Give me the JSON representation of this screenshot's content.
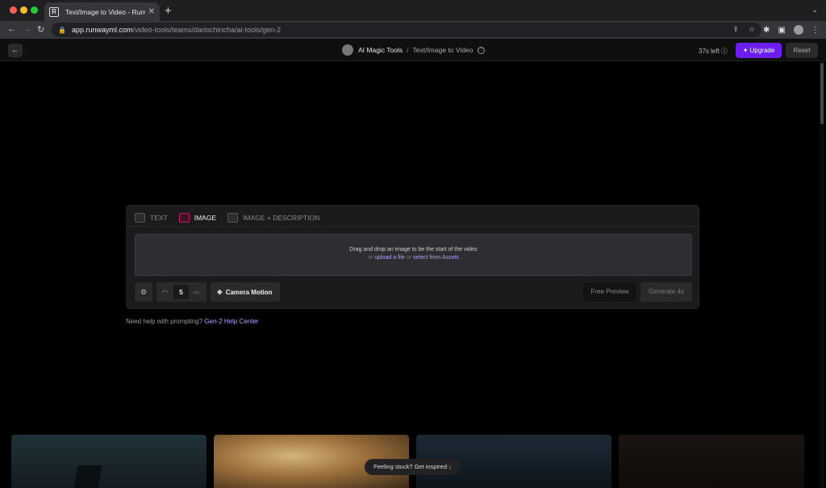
{
  "browser": {
    "tab_title": "Text/Image to Video - Runway",
    "favicon": "R",
    "url_host": "app.runwayml.com",
    "url_path": "/video-tools/teams/dariochincha/ai-tools/gen-2"
  },
  "header": {
    "breadcrumb_main": "AI Magic Tools",
    "breadcrumb_sep": "/",
    "breadcrumb_sub": "Text/Image to Video",
    "help_icon": "?",
    "time_left": "37s left ⓘ",
    "upgrade_label": "Upgrade",
    "reset_label": "Reset"
  },
  "panel": {
    "tabs": [
      {
        "label": "TEXT"
      },
      {
        "label": "IMAGE"
      },
      {
        "label": "IMAGE + DESCRIPTION"
      }
    ],
    "active_tab": "IMAGE",
    "dropzone": {
      "line1": "Drag and drop an image to be the start of the video",
      "or1": "or",
      "upload_link": "upload a file",
      "or2": "or",
      "assets_link": "select from Assets"
    },
    "motion_value": "5",
    "camera_motion_label": "Camera Motion",
    "free_preview_label": "Free Preview",
    "generate_label": "Generate 4s"
  },
  "help": {
    "text": "Need help with prompting?",
    "link": "Gen-2 Help Center"
  },
  "inspire": {
    "label": "Feeling stuck? Get inspired ↓"
  },
  "colors": {
    "accent": "#6c1ef0",
    "active_tab_underline": "#c2185b",
    "link": "#a9a4f8"
  }
}
